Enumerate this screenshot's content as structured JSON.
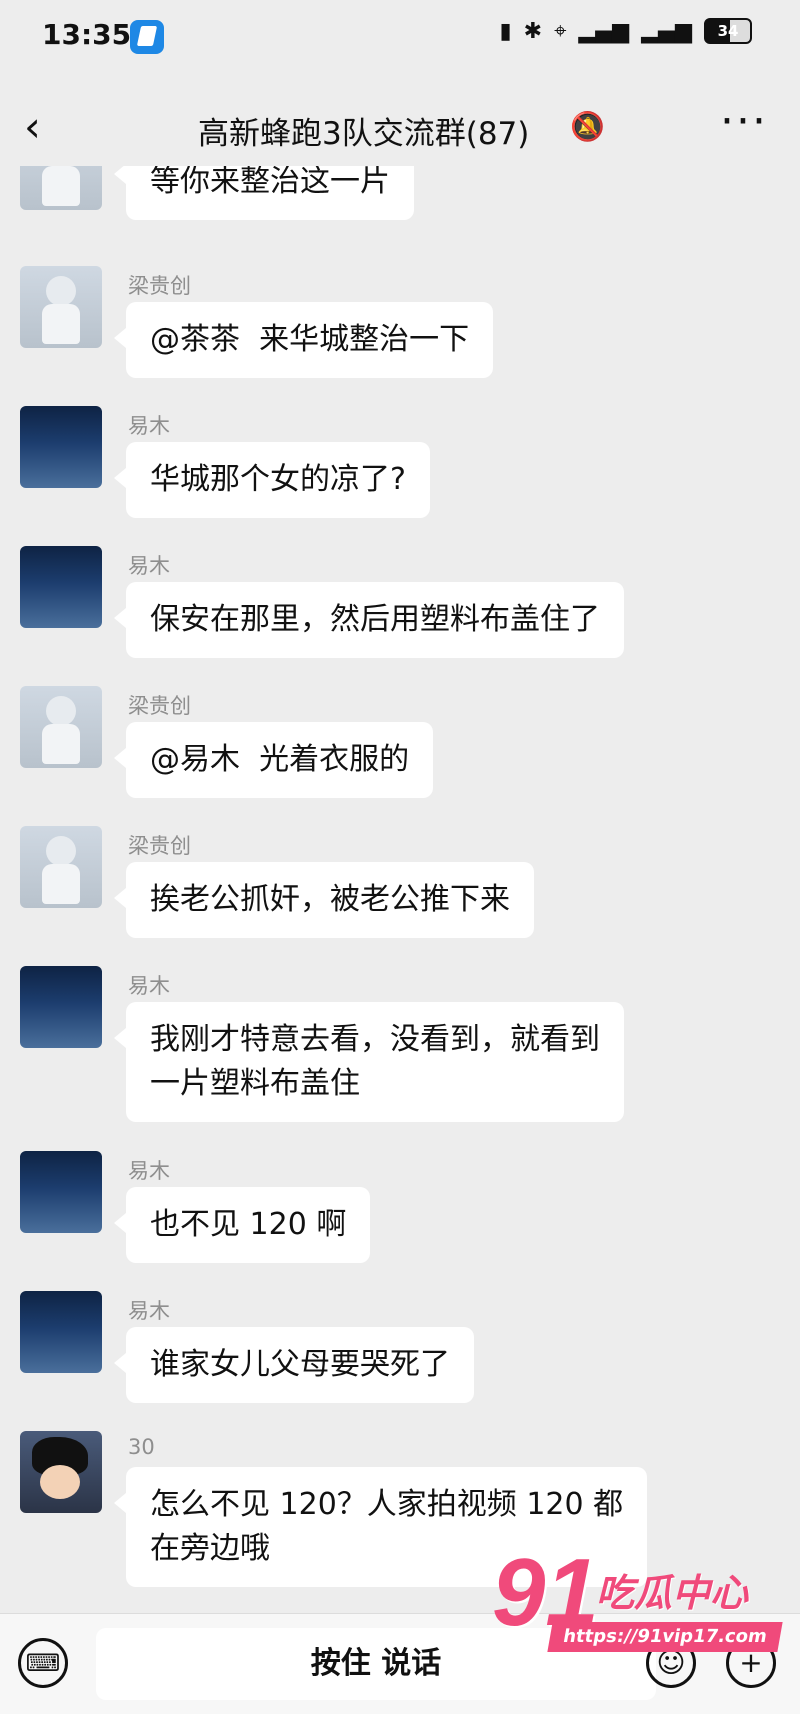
{
  "status": {
    "time": "13:35",
    "battery": "34"
  },
  "header": {
    "title": "高新蜂跑3队交流群(87)"
  },
  "messages": [
    {
      "sender": "",
      "text": "等你来整治这一片",
      "avatar": "person"
    },
    {
      "sender": "梁贵创",
      "text": "@茶茶  来华城整治一下",
      "avatar": "person"
    },
    {
      "sender": "易木",
      "text": "华城那个女的凉了?",
      "avatar": "star"
    },
    {
      "sender": "易木",
      "text": "保安在那里，然后用塑料布盖住了",
      "avatar": "star"
    },
    {
      "sender": "梁贵创",
      "text": "@易木  光着衣服的",
      "avatar": "person"
    },
    {
      "sender": "梁贵创",
      "text": "挨老公抓奸，被老公推下来",
      "avatar": "person"
    },
    {
      "sender": "易木",
      "text": "我刚才特意去看，没看到，就看到\n一片塑料布盖住",
      "avatar": "star"
    },
    {
      "sender": "易木",
      "text": "也不见 120 啊",
      "avatar": "star"
    },
    {
      "sender": "易木",
      "text": "谁家女儿父母要哭死了",
      "avatar": "star"
    },
    {
      "sender": "30",
      "text": "怎么不见 120？人家拍视频 120 都\n在旁边哦",
      "avatar": "anime"
    }
  ],
  "input": {
    "hold_to_talk": "按住 说话"
  },
  "watermark": {
    "brand": "91",
    "site_name": "吃瓜中心",
    "url": "https://91vip17.com"
  }
}
